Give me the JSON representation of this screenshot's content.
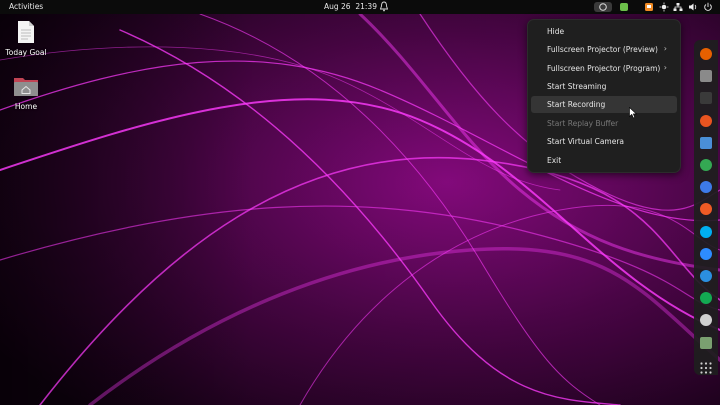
{
  "topbar": {
    "activities": "Activities",
    "date": "Aug 26",
    "time": "21:39",
    "tray_icons": [
      "obs-icon",
      "app-green-icon",
      "app-orange-icon",
      "weather-icon",
      "network-icon",
      "volume-icon",
      "power-icon"
    ]
  },
  "desktop": {
    "items": [
      {
        "label": "Today Goal",
        "icon": "document-icon"
      },
      {
        "label": "Home",
        "icon": "home-folder-icon"
      }
    ]
  },
  "menu": {
    "items": [
      {
        "label": "Hide",
        "submenu": false,
        "enabled": true
      },
      {
        "label": "Fullscreen Projector (Preview)",
        "submenu": true,
        "enabled": true
      },
      {
        "label": "Fullscreen Projector (Program)",
        "submenu": true,
        "enabled": true
      },
      {
        "label": "Start Streaming",
        "submenu": false,
        "enabled": true
      },
      {
        "label": "Start Recording",
        "submenu": false,
        "enabled": true,
        "highlighted": true
      },
      {
        "label": "Start Replay Buffer",
        "submenu": false,
        "enabled": false
      },
      {
        "label": "Start Virtual Camera",
        "submenu": false,
        "enabled": true
      },
      {
        "label": "Exit",
        "submenu": false,
        "enabled": true
      }
    ],
    "submenu_arrow": "›"
  },
  "dock": {
    "apps": [
      {
        "name": "firefox-icon",
        "color": "#e66000"
      },
      {
        "name": "files-icon",
        "color": "#8a8a8a"
      },
      {
        "name": "terminal-icon",
        "color": "#3a3a3a"
      },
      {
        "name": "software-icon",
        "color": "#e95420"
      },
      {
        "name": "text-editor-icon",
        "color": "#4a8fd8"
      },
      {
        "name": "chrome-icon",
        "color": "#34a853"
      },
      {
        "name": "chromium-icon",
        "color": "#3d7ae8"
      },
      {
        "name": "postman-icon",
        "color": "#ef5b25"
      },
      {
        "name": "skype-icon",
        "color": "#00aff0"
      },
      {
        "name": "zoom-icon",
        "color": "#2d8cff"
      },
      {
        "name": "vscode-icon",
        "color": "#2b8fe0"
      },
      {
        "name": "mongodb-compass-icon",
        "color": "#13aa52"
      },
      {
        "name": "obs-studio-icon",
        "color": "#d0d0d0"
      },
      {
        "name": "trash-icon",
        "color": "#7aa070"
      },
      {
        "name": "show-apps-icon",
        "color": "#cfcfcf"
      }
    ]
  },
  "colors": {
    "accent": "#d620d6",
    "topbar_bg": "#0b0b0b",
    "menu_bg": "#1f1f1f",
    "menu_highlight": "#353535"
  }
}
